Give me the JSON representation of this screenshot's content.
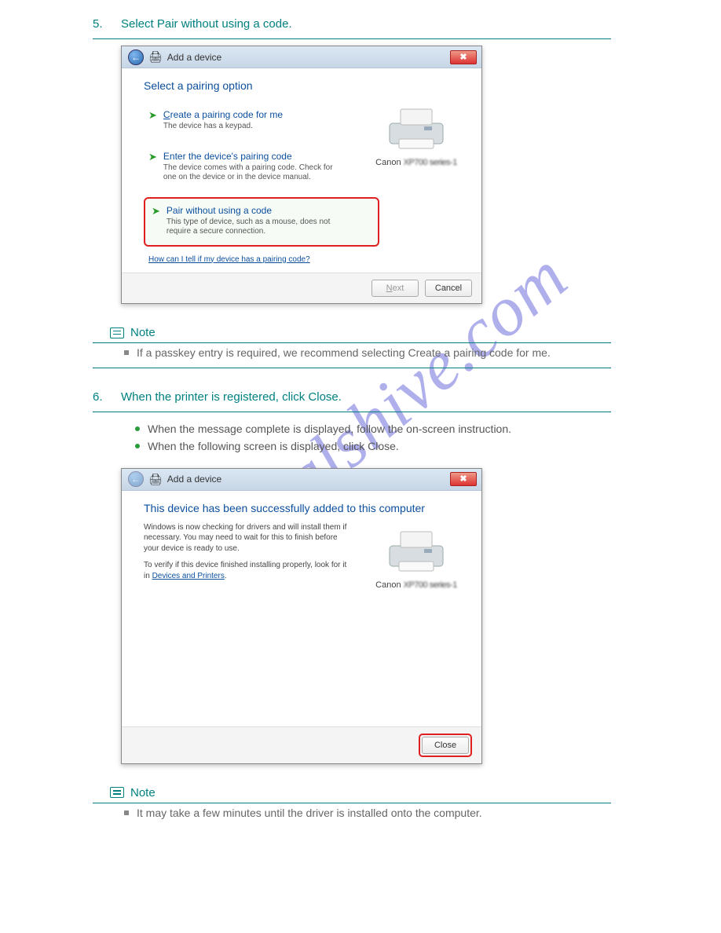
{
  "watermark": "Manualshive.com",
  "steps": {
    "s5": {
      "num": "5.",
      "text": "Select Pair without using a code."
    },
    "s6": {
      "num": "6.",
      "text": "When the printer is registered, click Close."
    }
  },
  "dialog1": {
    "title": "Add a device",
    "heading": "Select a pairing option",
    "option1": {
      "title_pre": "C",
      "title_rest": "reate a pairing code for me",
      "desc": "The device has a keypad."
    },
    "option2": {
      "title": "Enter the device's pairing code",
      "desc": "The device comes with a pairing code.\nCheck for one on the device or in the device manual."
    },
    "option3": {
      "title": "Pair without using a code",
      "desc": "This type of device, such as a mouse, does not require a secure connection."
    },
    "help_link": "How can I tell if my device has a pairing code?",
    "device_label_pre": "Canon ",
    "device_label_blur": "XP700 series-1",
    "btn_next": "Next",
    "btn_next_u": "N",
    "btn_cancel": "Cancel"
  },
  "note1": {
    "label": "Note",
    "items": [
      "If a passkey entry is required, we recommend selecting Create a pairing code for me."
    ]
  },
  "sub": {
    "a": "When the message complete is displayed, follow the on-screen instruction.",
    "b": "When the following screen is displayed, click Close."
  },
  "dialog2": {
    "title": "Add a device",
    "heading": "This device has been successfully added to this computer",
    "line1": "Windows is now checking for drivers and will install them if necessary. You may need to wait for this to finish before your device is ready to use.",
    "line2_pre": "To verify if this device finished installing properly, look for it in ",
    "line2_link": "Devices and Printers",
    "line2_post": ".",
    "device_label_pre": "Canon ",
    "device_label_blur": "XP700 series-1",
    "btn_close": "Close"
  },
  "note2": {
    "label": "Note",
    "items": [
      "It may take a few minutes until the driver is installed onto the computer."
    ]
  }
}
